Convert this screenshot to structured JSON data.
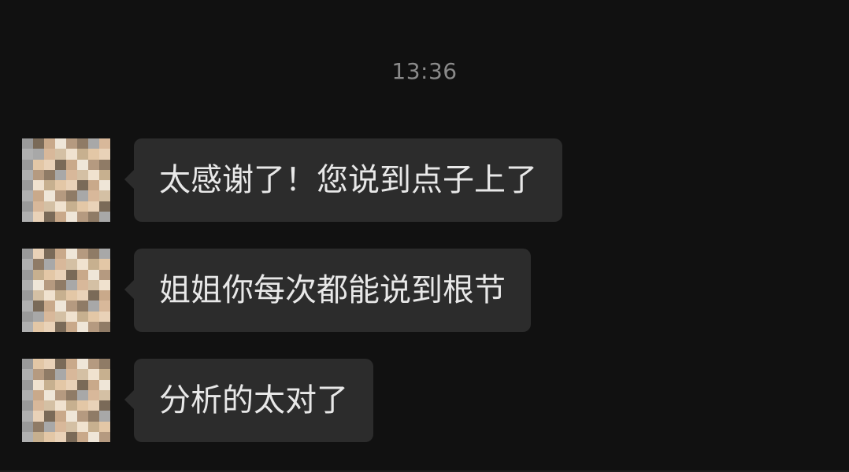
{
  "chat": {
    "timestamp": "13:36",
    "messages": [
      {
        "text": "太感谢了！您说到点子上了"
      },
      {
        "text": "姐姐你每次都能说到根节"
      },
      {
        "text": "分析的太对了"
      }
    ]
  },
  "avatar": {
    "description_icon": "pixelated-avatar-icon",
    "palette": [
      "#e9d2b8",
      "#d8b89a",
      "#c9a98a",
      "#f0e2cf",
      "#b59a80",
      "#e3c7a6",
      "#a8a8a8",
      "#7a6a58",
      "#d4c0a4",
      "#efe6d8",
      "#c7b08f",
      "#8f7b66"
    ]
  }
}
